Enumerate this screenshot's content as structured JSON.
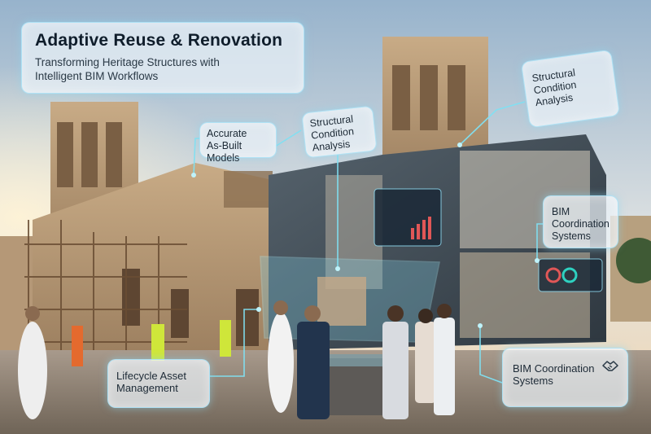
{
  "title_panel": {
    "title": "Adaptive Reuse & Renovation",
    "subtitle_line1": "Transforming Heritage Structures with",
    "subtitle_line2": "Intelligent BIM Workflows"
  },
  "callouts": {
    "as_built": {
      "line1": "Accurate",
      "line2": "As-Built Models"
    },
    "structural_mid": {
      "line1": "Structural",
      "line2": "Condition",
      "line3": "Analysis"
    },
    "structural_right": {
      "line1": "Structural",
      "line2": "Condition",
      "line3": "Analysis"
    },
    "bim_right": {
      "line1": "BIM",
      "line2": "Coordination",
      "line3": "Systems"
    },
    "bim_bottom": {
      "line1": "BIM Coordination",
      "line2": "Systems",
      "icon": "handshake-icon"
    },
    "lifecycle": {
      "line1": "Lifecycle Asset",
      "line2": "Management"
    }
  },
  "colors": {
    "sky_top": "#9fb9cf",
    "sky_horizon": "#f3d6ad",
    "stone": "#b99b78",
    "glass": "#3a4650",
    "callout_line": "#7fe0f2"
  }
}
